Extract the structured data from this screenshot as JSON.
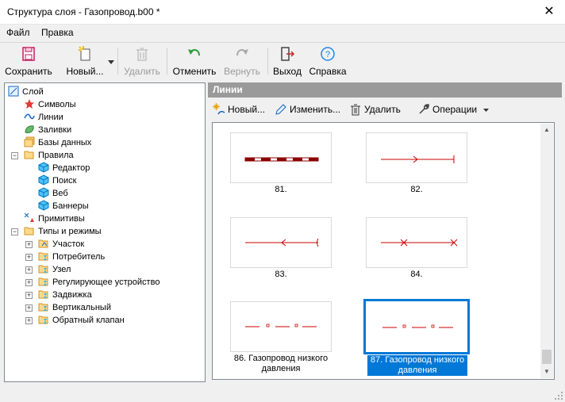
{
  "window": {
    "title": "Структура слоя - Газопровод.b00 *",
    "close_glyph": "✕"
  },
  "menu": {
    "file": "Файл",
    "help": "Правка"
  },
  "toolbar": {
    "save": "Сохранить",
    "new": "Новый...",
    "delete": "Удалить",
    "undo": "Отменить",
    "redo": "Вернуть",
    "exit": "Выход",
    "help": "Справка"
  },
  "tree": {
    "root": "Слой",
    "symbols": "Символы",
    "lines": "Линии",
    "fills": "Заливки",
    "databases": "Базы данных",
    "rules": "Правила",
    "rules_children": [
      "Редактор",
      "Поиск",
      "Веб",
      "Баннеры"
    ],
    "primitives": "Примитивы",
    "types": "Типы и режимы",
    "types_children": [
      "Участок",
      "Потребитель",
      "Узел",
      "Регулирующее устройство",
      "Задвижка",
      "Вертикальный",
      "Обратный клапан"
    ]
  },
  "panel": {
    "header": "Линии",
    "new": "Новый...",
    "edit": "Изменить...",
    "delete": "Удалить",
    "operations": "Операции"
  },
  "lines": [
    {
      "caption": "81.",
      "style": "dashed-bar"
    },
    {
      "caption": "82.",
      "style": "arrow-right"
    },
    {
      "caption": "83.",
      "style": "arrow-left"
    },
    {
      "caption": "84.",
      "style": "cross"
    },
    {
      "caption": "86. Газопровод низкого давления",
      "style": "dash-dot"
    },
    {
      "caption": "87. Газопровод низкого давления",
      "style": "dash-dot",
      "selected": true
    }
  ],
  "colors": {
    "line_red": "#cc0000",
    "accent_blue": "#0078d7",
    "panel_header": "#9a9a9a"
  }
}
